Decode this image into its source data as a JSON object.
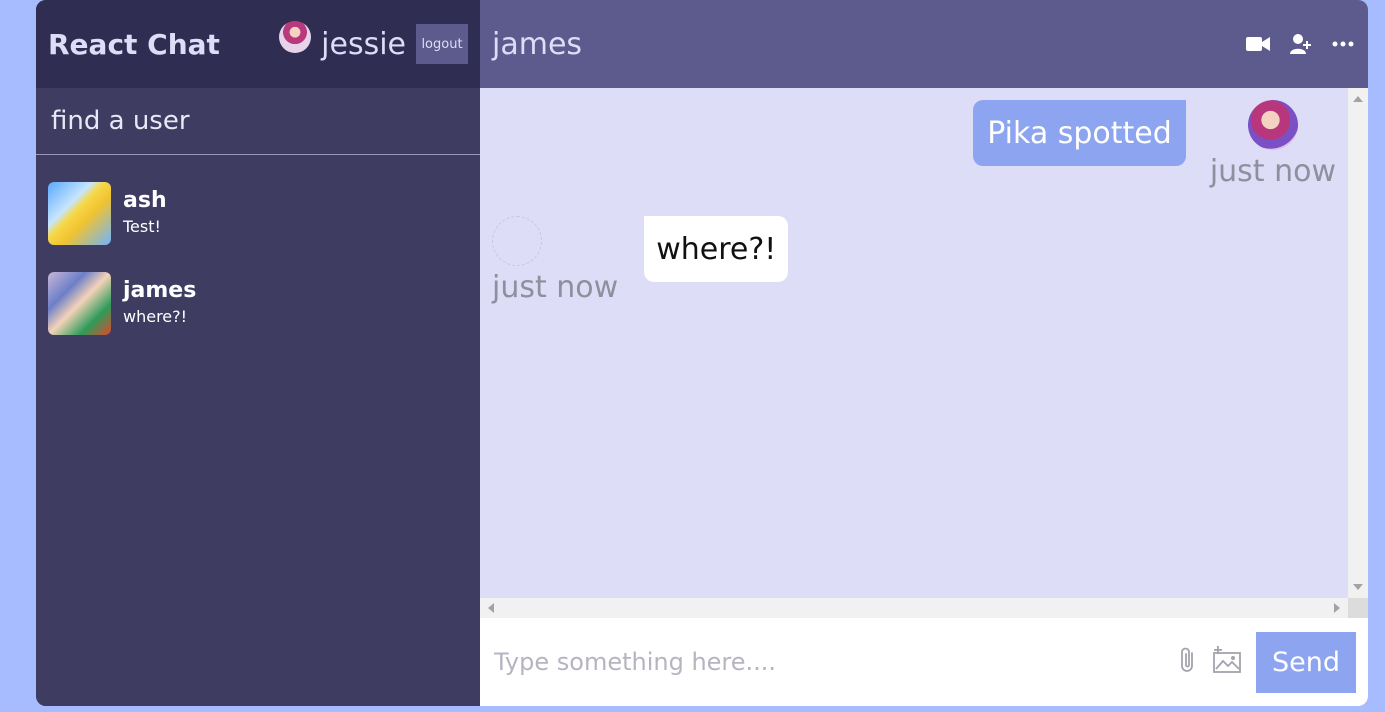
{
  "app": {
    "title": "React Chat",
    "current_user": "jessie",
    "logout_label": "logout"
  },
  "search": {
    "placeholder": "find a user"
  },
  "chats": [
    {
      "name": "ash",
      "last_message": "Test!"
    },
    {
      "name": "james",
      "last_message": "where?!"
    }
  ],
  "chat": {
    "title": "james",
    "icons": [
      "video-camera-icon",
      "add-user-icon",
      "more-options-icon"
    ],
    "messages": [
      {
        "from": "owner",
        "text": "Pika spotted",
        "time": "just now"
      },
      {
        "from": "other",
        "text": "where?!",
        "time": "just now"
      }
    ]
  },
  "input": {
    "placeholder": "Type something here....",
    "send_label": "Send",
    "icons": [
      "paperclip-icon",
      "add-image-icon"
    ]
  },
  "colors": {
    "background": "#a7bcff",
    "sidebar": "#3e3c61",
    "navbar": "#2f2d52",
    "chat_header": "#5d5b8d",
    "chat_area": "#ddddf7",
    "accent": "#8da4f1"
  }
}
